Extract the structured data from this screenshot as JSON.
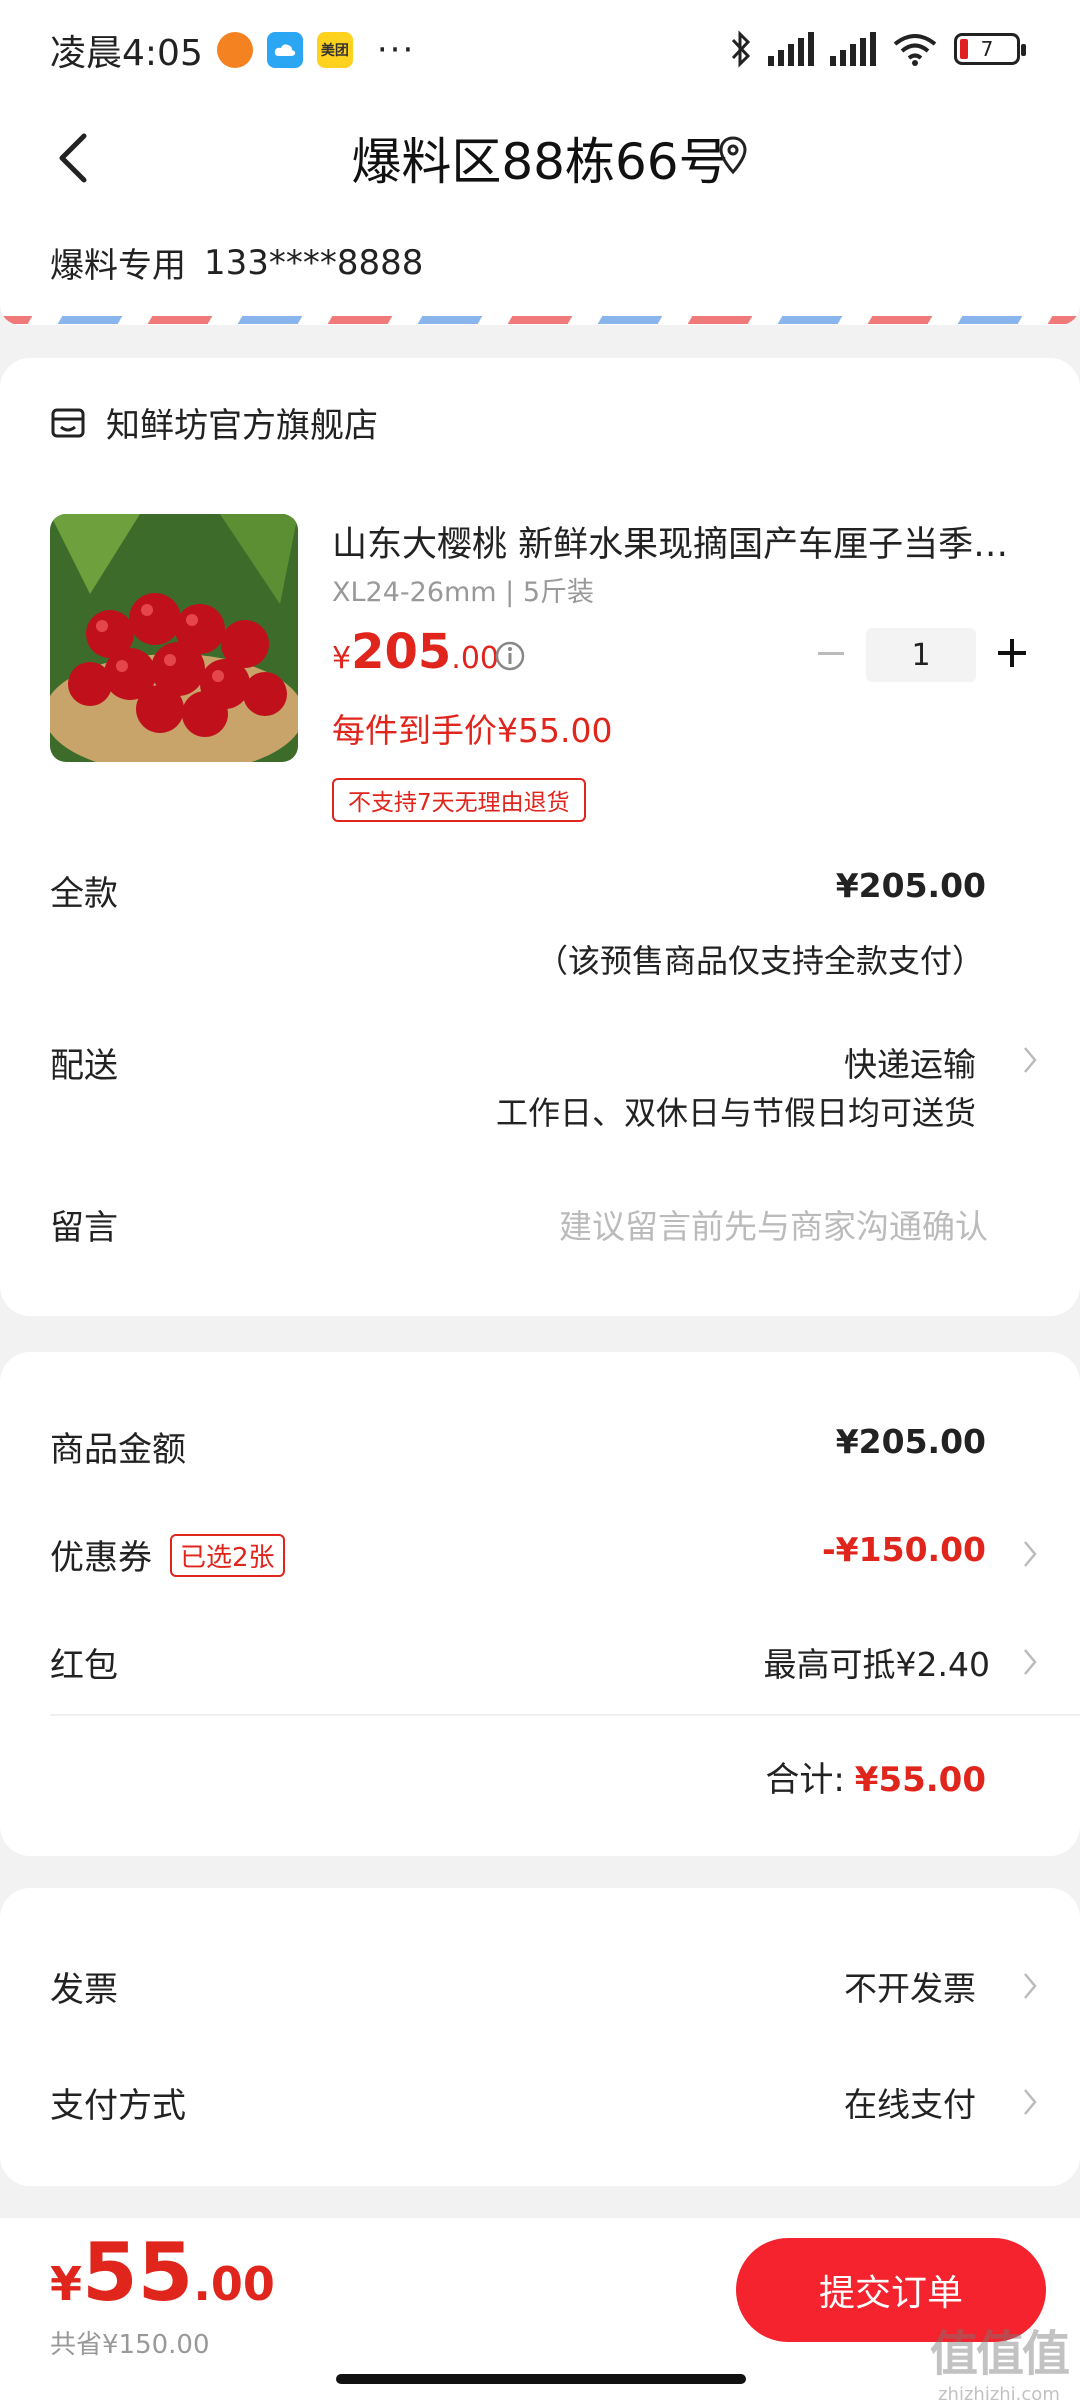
{
  "status_bar": {
    "time": "凌晨4:05",
    "icons": [
      "app-orange-icon",
      "cloud-app-icon",
      "meituan-app-icon"
    ],
    "meituan_label": "美团",
    "more": "···",
    "battery": "7"
  },
  "header": {
    "title": "爆料区88栋66号"
  },
  "contact": {
    "name": "爆料专用",
    "phone": "133****8888"
  },
  "store": {
    "name": "知鲜坊官方旗舰店",
    "product": {
      "title": "山东大樱桃 新鲜水果现摘国产车厘子当季…",
      "spec": "XL24-26mm | 5斤装",
      "price_currency": "¥",
      "price_int": "205",
      "price_dec": ".00",
      "quantity": "1",
      "unit_price": "每件到手价¥55.00",
      "tag": "不支持7天无理由退货"
    },
    "rows": {
      "fullpay_label": "全款",
      "fullpay_value": "¥205.00",
      "fullpay_note": "（该预售商品仅支持全款支付）",
      "delivery_label": "配送",
      "delivery_value": "快递运输",
      "delivery_note": "工作日、双休日与节假日均可送货",
      "message_label": "留言",
      "message_placeholder": "建议留言前先与商家沟通确认"
    }
  },
  "amounts": {
    "goods_label": "商品金额",
    "goods_value": "¥205.00",
    "coupon_label": "优惠券",
    "coupon_tag": "已选2张",
    "coupon_value": "-¥150.00",
    "redpacket_label": "红包",
    "redpacket_value": "最高可抵¥2.40",
    "total_label": "合计:",
    "total_value": "¥55.00"
  },
  "invoice": {
    "invoice_label": "发票",
    "invoice_value": "不开发票",
    "payment_label": "支付方式",
    "payment_value": "在线支付"
  },
  "bottom": {
    "currency": "¥",
    "amount_int": "55",
    "amount_dec": ".00",
    "saved": "共省¥150.00",
    "submit": "提交订单"
  },
  "watermark": {
    "logo": "值值值",
    "url": "zhizhizhi.com"
  },
  "colors": {
    "accent_red": "#e0251c",
    "button_red": "#f5232d",
    "background": "#f2f2f2"
  }
}
